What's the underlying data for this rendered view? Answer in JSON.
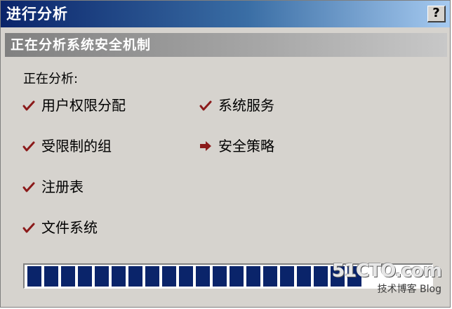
{
  "window": {
    "title": "进行分析",
    "help_label": "?"
  },
  "header": {
    "title": "正在分析系统安全机制"
  },
  "main": {
    "analyzing_label": "正在分析:",
    "items": [
      {
        "label": "用户权限分配",
        "status": "done",
        "icon": "check-icon"
      },
      {
        "label": "受限制的组",
        "status": "done",
        "icon": "check-icon"
      },
      {
        "label": "注册表",
        "status": "done",
        "icon": "check-icon"
      },
      {
        "label": "文件系统",
        "status": "done",
        "icon": "check-icon"
      },
      {
        "label": "系统服务",
        "status": "done",
        "icon": "check-icon"
      },
      {
        "label": "安全策略",
        "status": "in-progress",
        "icon": "arrow-right-icon"
      }
    ]
  },
  "progress": {
    "fraction": 0.83
  },
  "watermark": {
    "logo": "51CTO.com",
    "caption": "技术博客 Blog"
  },
  "colors": {
    "title_bar": "#0a246a",
    "status_mark": "#8b1a1a",
    "progress_fill": "#0a246a",
    "window_bg": "#d6d3ce"
  }
}
